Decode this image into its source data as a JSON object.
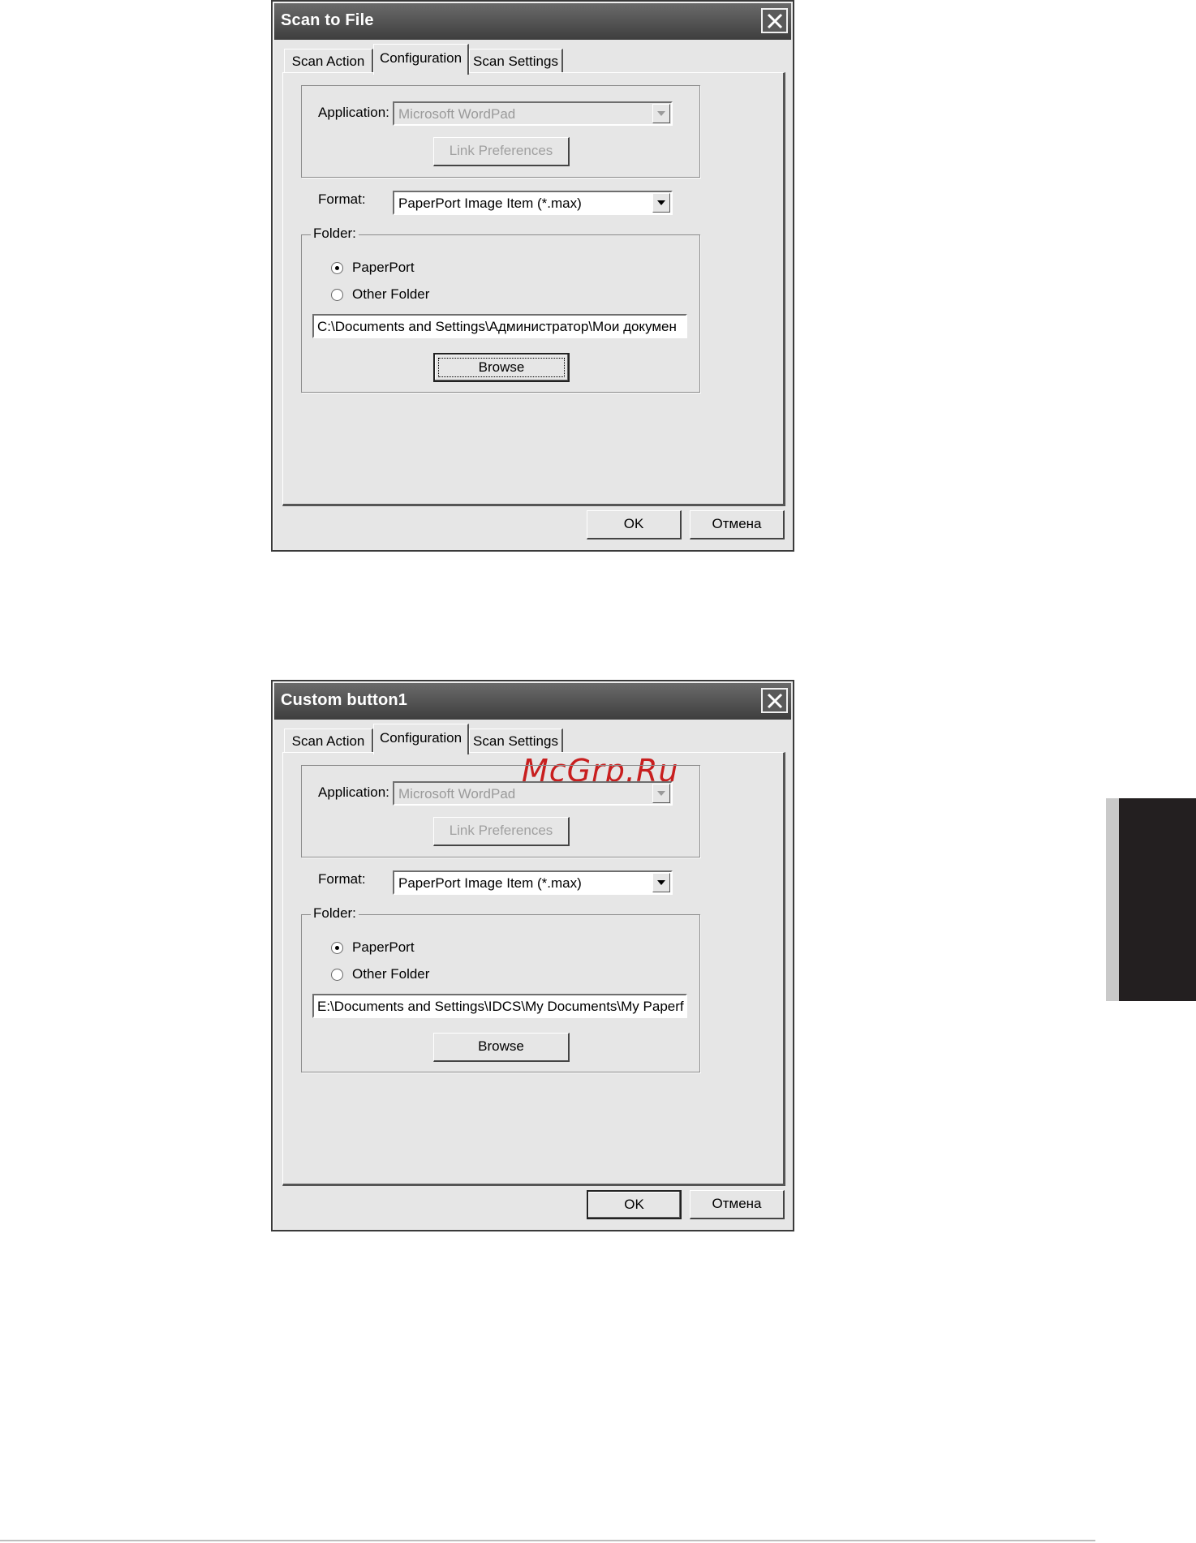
{
  "dialogs": [
    {
      "title": "Scan to File",
      "tabs": [
        "Scan Action",
        "Configuration",
        "Scan Settings"
      ],
      "application_label": "Application:",
      "application_value": "Microsoft WordPad",
      "link_preferences_label": "Link Preferences",
      "format_label": "Format:",
      "format_value": "PaperPort Image Item (*.max)",
      "folder_group_label": "Folder:",
      "radio_paperport": "PaperPort",
      "radio_other_folder": "Other Folder",
      "path_value": "C:\\Documents and Settings\\Администратор\\Мои докумен",
      "browse_label": "Browse",
      "ok_label": "OK",
      "cancel_label": "Отмена"
    },
    {
      "title": "Custom button1",
      "tabs": [
        "Scan Action",
        "Configuration",
        "Scan Settings"
      ],
      "application_label": "Application:",
      "application_value": "Microsoft WordPad",
      "link_preferences_label": "Link Preferences",
      "format_label": "Format:",
      "format_value": "PaperPort Image Item (*.max)",
      "folder_group_label": "Folder:",
      "radio_paperport": "PaperPort",
      "radio_other_folder": "Other Folder",
      "path_value": "E:\\Documents and Settings\\IDCS\\My Documents\\My Paperf",
      "browse_label": "Browse",
      "ok_label": "OK",
      "cancel_label": "Отмена"
    }
  ],
  "watermark": "McGrp.Ru",
  "colors": {
    "watermark": "#c81f1f",
    "side_tab": "#231f20",
    "dialog_bg": "#e6e6e6"
  }
}
